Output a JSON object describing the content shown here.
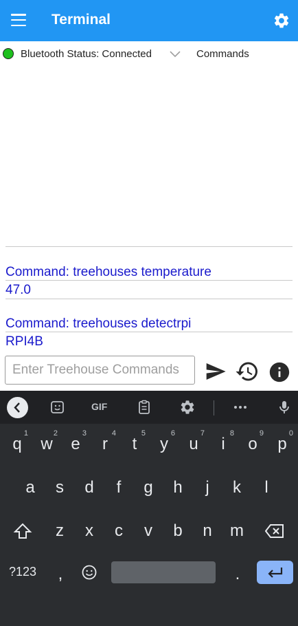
{
  "appbar": {
    "title": "Terminal",
    "menu_icon": "hamburger-menu-icon",
    "settings_icon": "gear-icon",
    "color": "#2196F3"
  },
  "status": {
    "label": "Bluetooth Status: Connected",
    "indicator_color": "#1ec01e",
    "dropdown_label": "Commands"
  },
  "log": [
    {
      "command": "Command:  treehouses temperature",
      "result": "47.0"
    },
    {
      "command": "Command:  treehouses detectrpi",
      "result": "RPI4B"
    }
  ],
  "input": {
    "placeholder": "Enter Treehouse Commands",
    "value": ""
  },
  "actions": {
    "send_icon": "send-icon",
    "history_icon": "history-icon",
    "info_icon": "info-icon"
  },
  "keyboard": {
    "toolbar": [
      "back-icon",
      "sticker-icon",
      "GIF",
      "clipboard-icon",
      "gear-icon",
      "more-icon",
      "mic-icon"
    ],
    "row1": [
      {
        "k": "q",
        "s": "1"
      },
      {
        "k": "w",
        "s": "2"
      },
      {
        "k": "e",
        "s": "3"
      },
      {
        "k": "r",
        "s": "4"
      },
      {
        "k": "t",
        "s": "5"
      },
      {
        "k": "y",
        "s": "6"
      },
      {
        "k": "u",
        "s": "7"
      },
      {
        "k": "i",
        "s": "8"
      },
      {
        "k": "o",
        "s": "9"
      },
      {
        "k": "p",
        "s": "0"
      }
    ],
    "row2": [
      "a",
      "s",
      "d",
      "f",
      "g",
      "h",
      "j",
      "k",
      "l"
    ],
    "row3": [
      "z",
      "x",
      "c",
      "v",
      "b",
      "n",
      "m"
    ],
    "symbols_label": "?123",
    "comma": ",",
    "period": ".",
    "enter_color": "#8ab4f8"
  }
}
